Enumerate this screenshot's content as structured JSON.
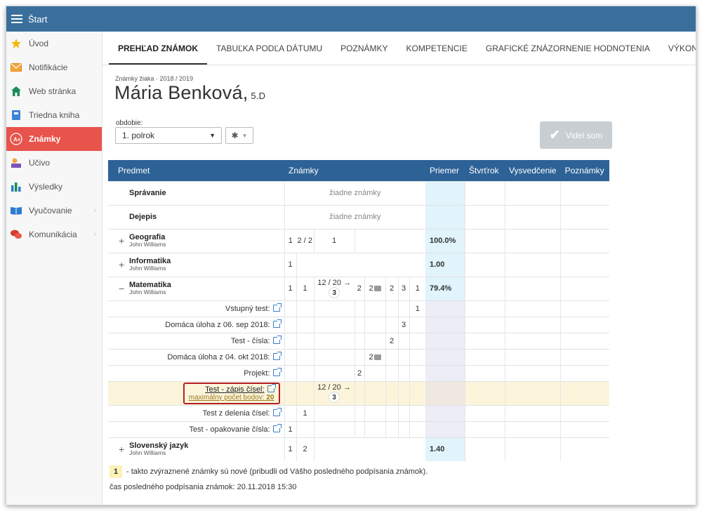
{
  "topbar": {
    "title": "Štart"
  },
  "sidebar": {
    "items": [
      {
        "label": "Úvod",
        "icon": "star-icon"
      },
      {
        "label": "Notifikácie",
        "icon": "envelope-icon"
      },
      {
        "label": "Web stránka",
        "icon": "home-icon"
      },
      {
        "label": "Triedna kniha",
        "icon": "book-icon"
      },
      {
        "label": "Známky",
        "icon": "grade-icon"
      },
      {
        "label": "Učivo",
        "icon": "learning-icon"
      },
      {
        "label": "Výsledky",
        "icon": "bar-chart-icon"
      },
      {
        "label": "Vyučovanie",
        "icon": "open-book-icon"
      },
      {
        "label": "Komunikácia",
        "icon": "chat-bubbles-icon"
      }
    ],
    "active": "Známky"
  },
  "tabs": [
    "PREHĽAD ZNÁMOK",
    "TABUĽKA PODĽA DÁTUMU",
    "POZNÁMKY",
    "KOMPETENCIE",
    "GRAFICKÉ ZNÁZORNENIE HODNOTENIA",
    "VÝKONNOSŤ"
  ],
  "header": {
    "subtitle": "Známky žiaka · 2018 / 2019",
    "student_name": "Mária Benková,",
    "student_class": "5.D"
  },
  "period": {
    "label": "obdobie:",
    "value": "1. polrok"
  },
  "videl_button": "Videl som",
  "table": {
    "headers": {
      "subject": "Predmet",
      "grades": "Známky",
      "average": "Priemer",
      "quarter": "Štvrťrok",
      "report": "Vysvedčenie",
      "notes": "Poznámky"
    },
    "no_grades": "žiadne známky",
    "subjects": {
      "spravanie": "Správanie",
      "dejepis": "Dejepis",
      "geografia": {
        "name": "Geografia",
        "teacher": "John Williams",
        "g1": "1",
        "g2": "2 / 2",
        "g3": "1",
        "avg": "100.0%"
      },
      "informatika": {
        "name": "Informatika",
        "teacher": "John Williams",
        "g1": "1",
        "avg": "1.00"
      },
      "matematika": {
        "name": "Matematika",
        "teacher": "John Williams",
        "g1": "1",
        "g2": "1",
        "g3": "12 / 20 →",
        "g3c": "3",
        "g4": "2",
        "g5": "2",
        "g6": "2",
        "g7": "3",
        "g8": "1",
        "avg": "79.4%"
      },
      "slovensky": {
        "name": "Slovenský jazyk",
        "teacher": "John Williams",
        "g1": "1",
        "g2": "2",
        "avg": "1.40"
      }
    },
    "math_details": [
      {
        "label": "Vstupný test:",
        "grade": "1"
      },
      {
        "label": "Domáca úloha z 06. sep 2018:",
        "grade": "3"
      },
      {
        "label": "Test - čísla:",
        "grade": "2"
      },
      {
        "label": "Domáca úloha z 04. okt 2018:",
        "grade": "2"
      },
      {
        "label": "Projekt:",
        "grade": "2"
      },
      {
        "label": "Test - zápis čísel:",
        "sublabel": "maximálny počet bodov:",
        "subvalue": "20",
        "grade": "12 / 20 →",
        "gradec": "3"
      },
      {
        "label": "Test z delenia čísel:",
        "grade": "1"
      },
      {
        "label": "Test - opakovanie čísla:",
        "grade": "1"
      }
    ]
  },
  "legend": {
    "sample": "1",
    "text": "- takto zvýraznené známky sú nové (pribudli od Vášho posledného podpísania známok).",
    "sign_time": "čas posledného podpísania známok: 20.11.2018 15:30"
  },
  "colors": {
    "topbar": "#3a6f9c",
    "active_sidebar": "#e8534b",
    "table_header": "#2d6296",
    "highlight_border": "#b52025"
  }
}
